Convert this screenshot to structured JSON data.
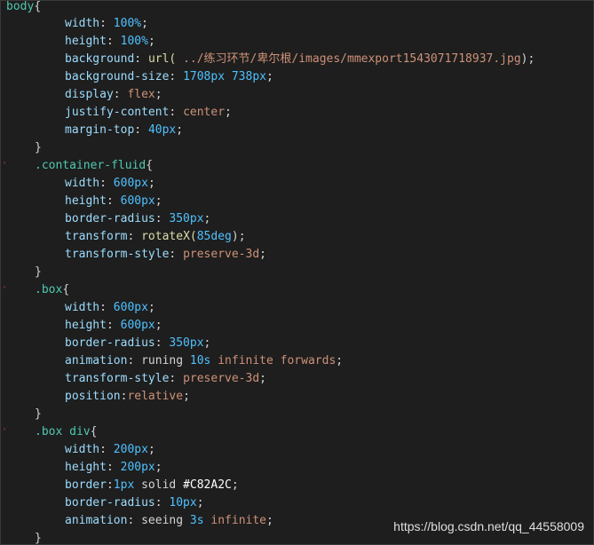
{
  "code": {
    "l1_selector": "body",
    "l1_brace": "{",
    "l2_prop": "width",
    "l2_val": "100%",
    "l3_prop": "height",
    "l3_val": "100%",
    "l4_prop": "background",
    "l4_func": "url(",
    "l4_path": " ../练习环节/卑尔根/images/mmexport1543071718937.jpg",
    "l4_close": ");",
    "l5_prop": "background-size",
    "l5_val": "1708px 738px",
    "l6_prop": "display",
    "l6_val": "flex",
    "l7_prop": "justify-content",
    "l7_val": "center",
    "l8_prop": "margin-top",
    "l8_val": "40px",
    "l9_brace": "}",
    "l10_selector": ".container-fluid",
    "l10_brace": "{",
    "l11_prop": "width",
    "l11_val": "600px",
    "l12_prop": "height",
    "l12_val": "600px",
    "l13_prop": "border-radius",
    "l13_val": "350px",
    "l14_prop": "transform",
    "l14_func": "rotateX(",
    "l14_num": "85deg",
    "l14_close": ");",
    "l15_prop": "transform-style",
    "l15_val": "preserve-3d",
    "l16_brace": "}",
    "l17_selector": ".box",
    "l17_brace": "{",
    "l18_prop": "width",
    "l18_val": "600px",
    "l19_prop": "height",
    "l19_val": "600px",
    "l20_prop": "border-radius",
    "l20_val": "350px",
    "l21_prop": "animation",
    "l21_name": "runing",
    "l21_dur": "10s",
    "l21_rest": "infinite forwards",
    "l22_prop": "transform-style",
    "l22_val": "preserve-3d",
    "l23_prop": "position",
    "l23_val": "relative",
    "l24_brace": "}",
    "l25_selector": ".box div",
    "l25_brace": "{",
    "l26_prop": "width",
    "l26_val": "200px",
    "l27_prop": "height",
    "l27_val": "200px",
    "l28_prop": "border",
    "l28_num": "1px",
    "l28_solid": "solid",
    "l28_hex": "#C82A2C",
    "l29_prop": "border-radius",
    "l29_val": "10px",
    "l30_prop": "animation",
    "l30_name": "seeing",
    "l30_dur": "3s",
    "l30_rest": "infinite",
    "l31_brace": "}"
  },
  "watermark": "https://blog.csdn.net/qq_44558009",
  "colors": {
    "background": "#1e1e1e",
    "selector": "#4ec9b0",
    "property": "#9cdcfe",
    "number": "#4fc1ff",
    "value": "#ce9178",
    "gutter_marker": "#c0392b"
  }
}
